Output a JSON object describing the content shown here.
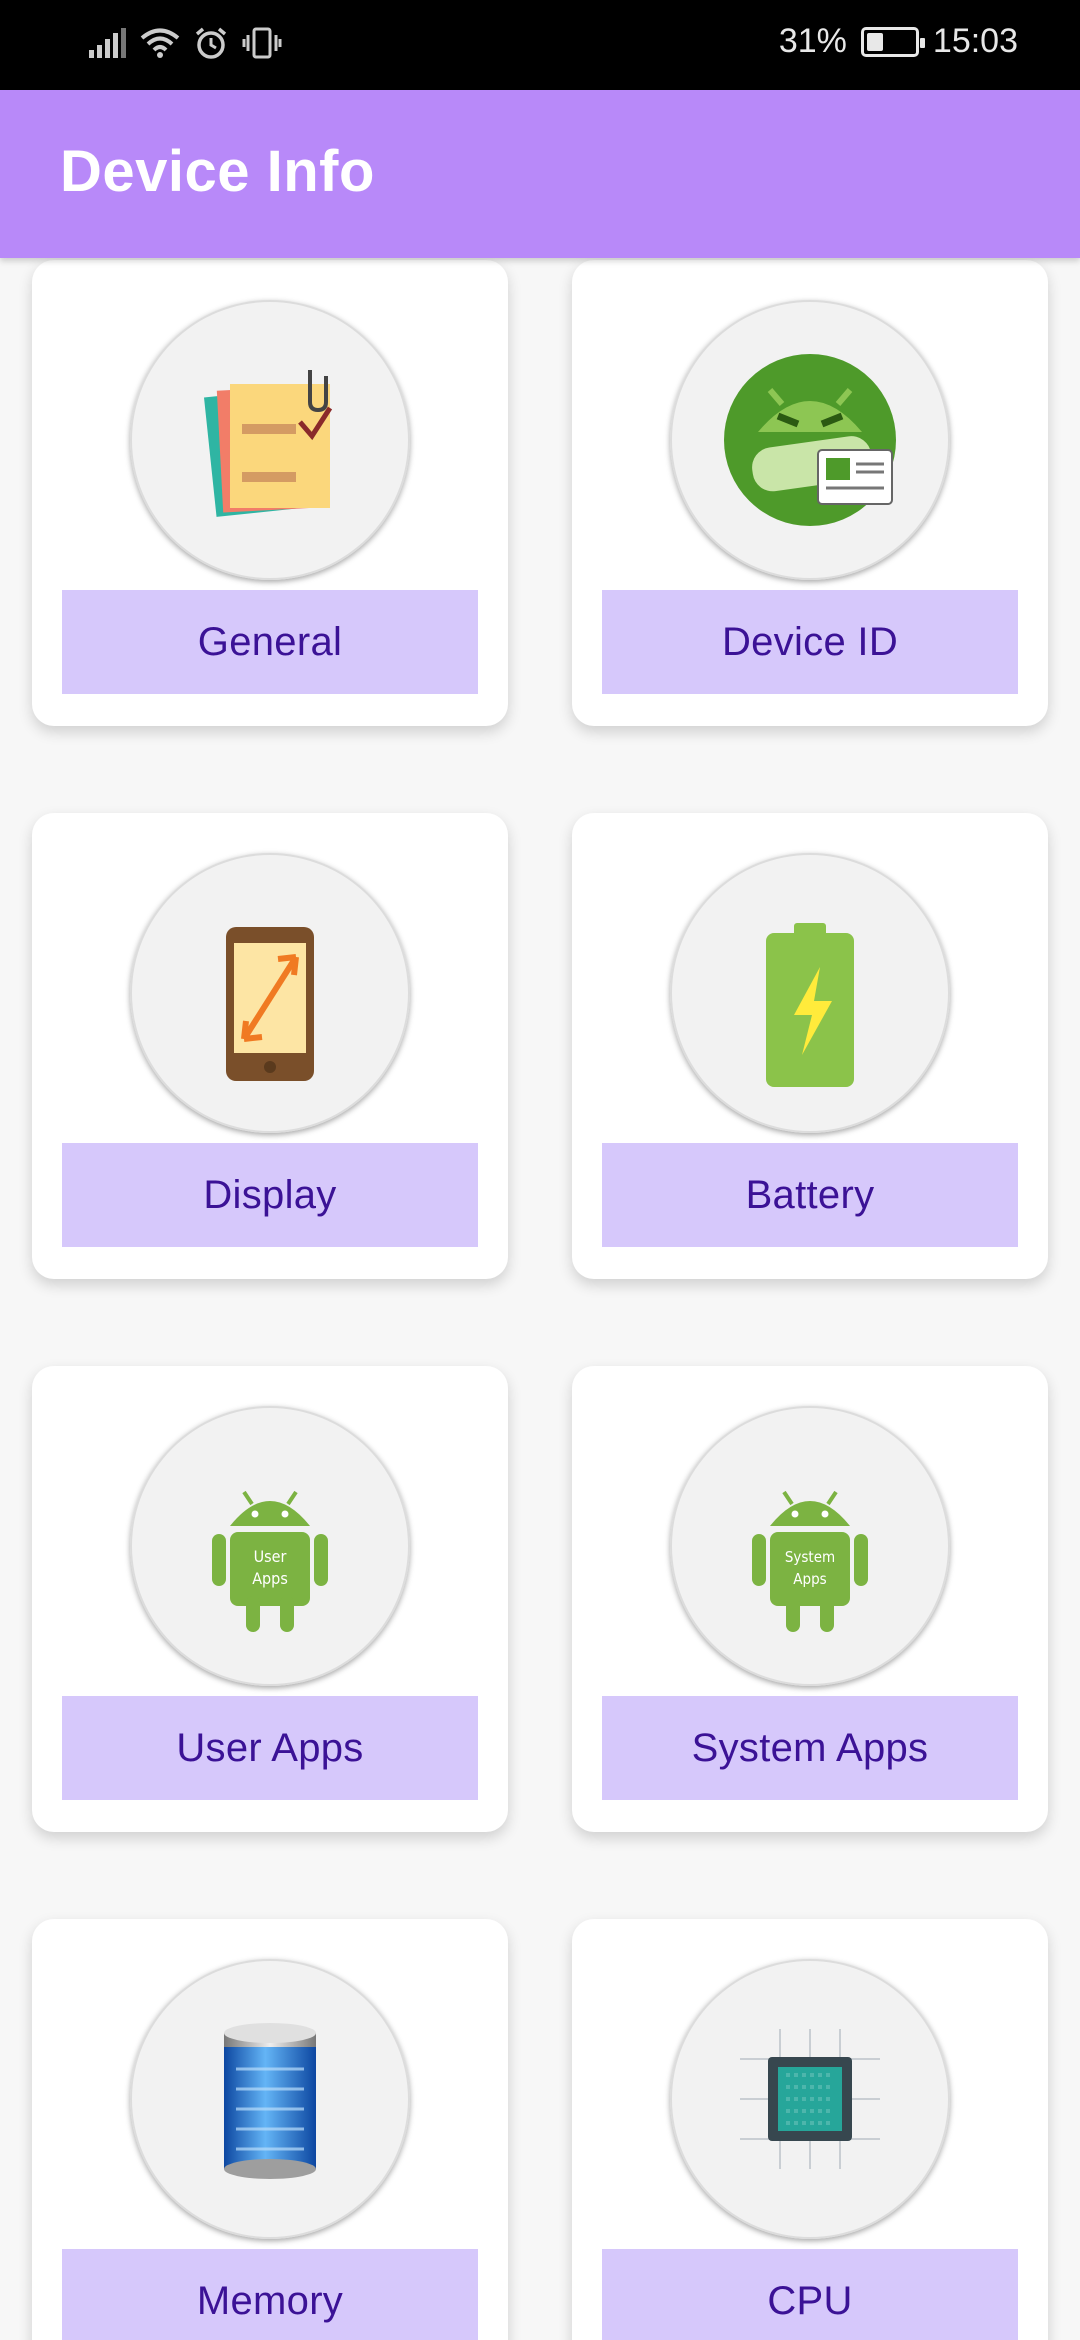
{
  "status_bar": {
    "battery_percent": "31%",
    "battery_level": 0.31,
    "time": "15:03",
    "icons": [
      "signal-icon",
      "wifi-icon",
      "alarm-icon",
      "vibrate-icon"
    ]
  },
  "app_bar": {
    "title": "Device Info",
    "color": "#b889f9"
  },
  "tiles": [
    {
      "label": "General",
      "icon": "clipboard-icon"
    },
    {
      "label": "Device ID",
      "icon": "android-id-icon"
    },
    {
      "label": "Display",
      "icon": "phone-display-icon"
    },
    {
      "label": "Battery",
      "icon": "battery-icon"
    },
    {
      "label": "User Apps",
      "icon": "android-user-apps-icon",
      "icon_text": [
        "User",
        "Apps"
      ]
    },
    {
      "label": "System Apps",
      "icon": "android-system-apps-icon",
      "icon_text": [
        "System",
        "Apps"
      ]
    },
    {
      "label": "Memory",
      "icon": "memory-icon"
    },
    {
      "label": "CPU",
      "icon": "cpu-icon"
    }
  ],
  "colors": {
    "tile_label_bg": "#d6c8fb",
    "tile_label_text": "#3b1296"
  }
}
